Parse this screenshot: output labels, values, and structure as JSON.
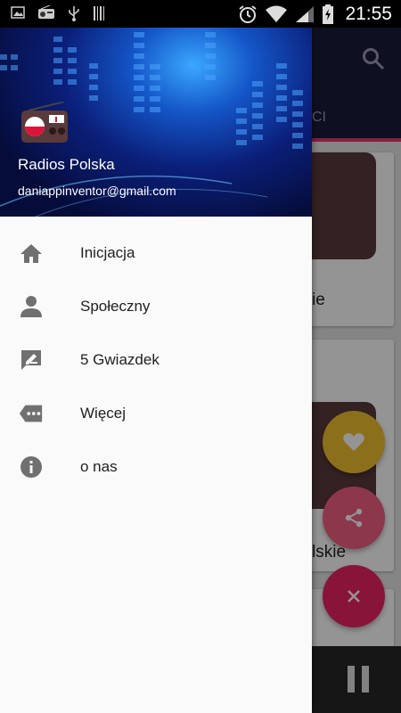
{
  "status_bar": {
    "time": "21:55"
  },
  "background_app": {
    "tab_fragment": "CI",
    "card_text_1": "ie",
    "card_text_2": "lskie"
  },
  "drawer": {
    "app_name": "Radios Polska",
    "email": "daniappinventor@gmail.com",
    "items": [
      {
        "label": "Inicjacja",
        "icon": "home-icon"
      },
      {
        "label": "Społeczny",
        "icon": "person-icon"
      },
      {
        "label": "5 Gwiazdek",
        "icon": "rate-review-icon"
      },
      {
        "label": "Więcej",
        "icon": "more-tag-icon"
      },
      {
        "label": "o nas",
        "icon": "info-icon"
      }
    ]
  },
  "colors": {
    "accent_pink": "#e9346f",
    "toolbar_dark": "#1b1a3b",
    "fab_yellow": "#f0c030",
    "fab_pink": "#f25f84",
    "fab_red": "#ec2463"
  }
}
